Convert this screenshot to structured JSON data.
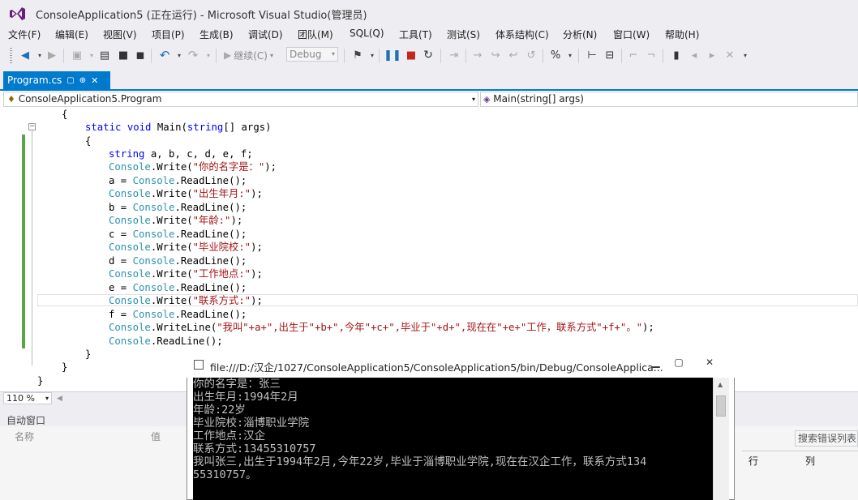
{
  "window": {
    "title": "ConsoleApplication5 (正在运行) - Microsoft Visual Studio(管理员)"
  },
  "menu": [
    {
      "label": "文件(F)"
    },
    {
      "label": "编辑(E)"
    },
    {
      "label": "视图(V)"
    },
    {
      "label": "项目(P)"
    },
    {
      "label": "生成(B)"
    },
    {
      "label": "调试(D)"
    },
    {
      "label": "团队(M)"
    },
    {
      "label": "SQL(Q)"
    },
    {
      "label": "工具(T)"
    },
    {
      "label": "测试(S)"
    },
    {
      "label": "体系结构(C)"
    },
    {
      "label": "分析(N)"
    },
    {
      "label": "窗口(W)"
    },
    {
      "label": "帮助(H)"
    }
  ],
  "toolbar": {
    "continue_label": "继续(C)",
    "config_value": "Debug"
  },
  "tab": {
    "label": "Program.cs",
    "pin": "⊕",
    "close": "✕"
  },
  "navbar": {
    "class_value": "ConsoleApplication5.Program",
    "member_value": "Main(string[] args)"
  },
  "code": {
    "open_brace_1": "{",
    "sig_kw1": "static",
    "sig_kw2": "void",
    "sig_name": "Main(",
    "sig_kw3": "string",
    "sig_rest": "[] args)",
    "open_brace_2": "{",
    "decl_kw": "string",
    "decl_rest": " a, b, c, d, e, f;",
    "lines": [
      {
        "type": "Console",
        "method": ".Write(",
        "str": "\"你的名字是：\"",
        "end": ");"
      },
      {
        "var": "a = ",
        "type": "Console",
        "method": ".ReadLine();"
      },
      {
        "type": "Console",
        "method": ".Write(",
        "str": "\"出生年月:\"",
        "end": ");"
      },
      {
        "var": "b = ",
        "type": "Console",
        "method": ".ReadLine();"
      },
      {
        "type": "Console",
        "method": ".Write(",
        "str": "\"年龄:\"",
        "end": ");"
      },
      {
        "var": "c = ",
        "type": "Console",
        "method": ".ReadLine();"
      },
      {
        "type": "Console",
        "method": ".Write(",
        "str": "\"毕业院校:\"",
        "end": ");"
      },
      {
        "var": "d = ",
        "type": "Console",
        "method": ".ReadLine();"
      },
      {
        "type": "Console",
        "method": ".Write(",
        "str": "\"工作地点:\"",
        "end": ");"
      },
      {
        "var": "e = ",
        "type": "Console",
        "method": ".ReadLine();"
      },
      {
        "type": "Console",
        "method": ".Write(",
        "str": "\"联系方式:\"",
        "end": ");"
      },
      {
        "var": "f = ",
        "type": "Console",
        "method": ".ReadLine();"
      }
    ],
    "writeline_type": "Console",
    "writeline_rest": ".WriteLine(",
    "writeline_args": "\"我叫\"+a+\",出生于\"+b+\",今年\"+c+\",毕业于\"+d+\",现在在\"+e+\"工作，联系方式\"+f+\"。\"",
    "writeline_end": ");",
    "readline_type": "Console",
    "readline_rest": ".ReadLine();",
    "close_brace_1": "}",
    "close_brace_2": "}",
    "close_brace_3": "}"
  },
  "zoom": {
    "value": "110 %"
  },
  "auto_window": {
    "title": "自动窗口",
    "col_name": "名称",
    "col_value": "值"
  },
  "error_list": {
    "search": "搜索错误列表",
    "col_line": "行",
    "col_col": "列"
  },
  "console": {
    "title": "file:///D:/汉企/1027/ConsoleApplication5/ConsoleApplication5/bin/Debug/ConsoleApplica...",
    "lines": [
      "你的名字是：张三",
      "出生年月:1994年2月",
      "年龄:22岁",
      "毕业院校:淄博职业学院",
      "工作地点:汉企",
      "联系方式:13455310757",
      "我叫张三,出生于1994年2月,今年22岁,毕业于淄博职业学院,现在在汉企工作，联系方式134",
      "55310757。"
    ]
  },
  "colors": {
    "accent": "#007acc",
    "keyword": "#0000ff",
    "type": "#2b91af",
    "string": "#a31515",
    "margin_changed": "#57a64a"
  }
}
